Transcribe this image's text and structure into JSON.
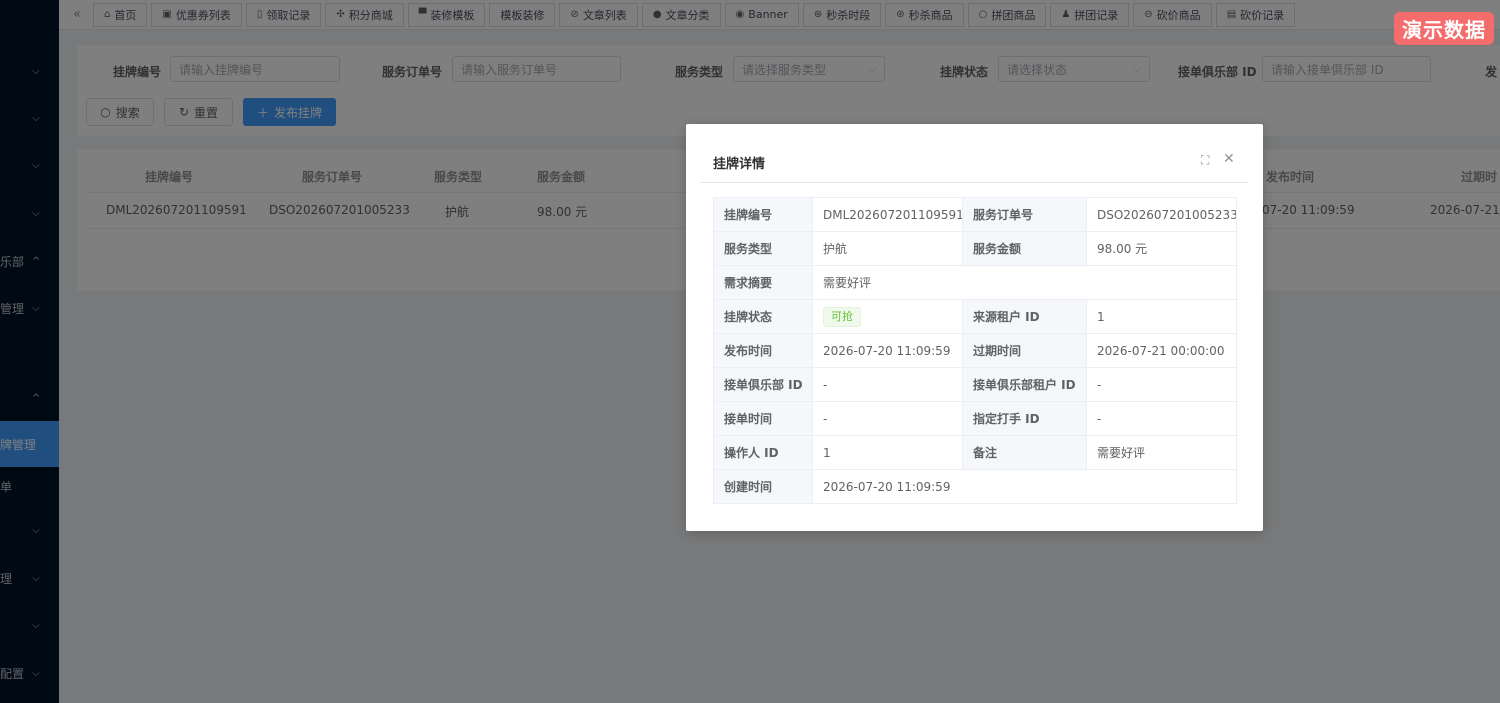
{
  "sidebar": {
    "items": [
      {
        "label": "",
        "chevron": "⌵"
      },
      {
        "label": "",
        "chevron": "⌵"
      },
      {
        "label": "",
        "chevron": "⌵"
      },
      {
        "label": "",
        "chevron": "⌵"
      },
      {
        "label": "乐部",
        "chevron": "^"
      },
      {
        "label": "管理",
        "chevron": "⌵"
      },
      {
        "label": "",
        "chevron": "^"
      },
      {
        "label": "牌管理",
        "chevron": ""
      },
      {
        "label": "单",
        "chevron": ""
      },
      {
        "label": "",
        "chevron": "⌵"
      },
      {
        "label": "理",
        "chevron": "⌵"
      },
      {
        "label": "",
        "chevron": "⌵"
      },
      {
        "label": "配置",
        "chevron": "⌵"
      }
    ]
  },
  "tags": [
    {
      "label": "首页",
      "icon": "home-icon",
      "glyph": "⌂"
    },
    {
      "label": "优惠券列表",
      "icon": "coupon-icon",
      "glyph": "▣"
    },
    {
      "label": "领取记录",
      "icon": "bookmark-icon",
      "glyph": "▯"
    },
    {
      "label": "积分商城",
      "icon": "points-icon",
      "glyph": "✣"
    },
    {
      "label": "装修模板",
      "icon": "template-icon",
      "glyph": "▀"
    },
    {
      "label": "模板装修",
      "icon": "",
      "glyph": ""
    },
    {
      "label": "文章列表",
      "icon": "article-icon",
      "glyph": "⊘"
    },
    {
      "label": "文章分类",
      "icon": "category-icon",
      "glyph": "●"
    },
    {
      "label": "Banner",
      "icon": "banner-icon",
      "glyph": "◉"
    },
    {
      "label": "秒杀时段",
      "icon": "seckill-time-icon",
      "glyph": "⊛"
    },
    {
      "label": "秒杀商品",
      "icon": "seckill-goods-icon",
      "glyph": "⊛"
    },
    {
      "label": "拼团商品",
      "icon": "group-goods-icon",
      "glyph": "○"
    },
    {
      "label": "拼团记录",
      "icon": "user-icon",
      "glyph": "♟"
    },
    {
      "label": "砍价商品",
      "icon": "bargain-goods-icon",
      "glyph": "⊖"
    },
    {
      "label": "砍价记录",
      "icon": "bargain-record-icon",
      "glyph": "▤"
    }
  ],
  "demo_badge": "演示数据",
  "filters": {
    "listing_no": {
      "label": "挂牌编号",
      "placeholder": "请输入挂牌编号"
    },
    "order_no": {
      "label": "服务订单号",
      "placeholder": "请输入服务订单号"
    },
    "service_type": {
      "label": "服务类型",
      "placeholder": "请选择服务类型"
    },
    "status": {
      "label": "挂牌状态",
      "placeholder": "请选择状态"
    },
    "club_id": {
      "label": "接单俱乐部 ID",
      "placeholder": "请输入接单俱乐部 ID"
    },
    "publish_cut": "发"
  },
  "buttons": {
    "search": "搜索",
    "reset": "重置",
    "publish": "发布挂牌"
  },
  "table": {
    "headers": [
      "挂牌编号",
      "服务订单号",
      "服务类型",
      "服务金额",
      "发布时间",
      "过期时"
    ],
    "row": {
      "listing_no": "DML202607201109591",
      "order_no": "DSO202607201005233",
      "service_type": "护航",
      "amount": "98.00 元",
      "publish_time_cut": "07-20 11:09:59",
      "expire_time_cut": "2026-07-21 0"
    }
  },
  "dialog": {
    "title": "挂牌详情",
    "rows": [
      {
        "k1": "挂牌编号",
        "v1": "DML202607201109591",
        "k2": "服务订单号",
        "v2": "DSO202607201005233"
      },
      {
        "k1": "服务类型",
        "v1": "护航",
        "k2": "服务金额",
        "v2": "98.00 元"
      },
      {
        "k1": "需求摘要",
        "v1": "需要好评"
      },
      {
        "k1": "挂牌状态",
        "v1": "可抢",
        "k2": "来源租户 ID",
        "v2": "1"
      },
      {
        "k1": "发布时间",
        "v1": "2026-07-20 11:09:59",
        "k2": "过期时间",
        "v2": "2026-07-21 00:00:00"
      },
      {
        "k1": "接单俱乐部 ID",
        "v1": "-",
        "k2": "接单俱乐部租户 ID",
        "v2": "-"
      },
      {
        "k1": "接单时间",
        "v1": "-",
        "k2": "指定打手 ID",
        "v2": "-"
      },
      {
        "k1": "操作人 ID",
        "v1": "1",
        "k2": "备注",
        "v2": "需要好评"
      },
      {
        "k1": "创建时间",
        "v1": "2026-07-20 11:09:59"
      }
    ]
  },
  "colors": {
    "primary": "#409eff",
    "sidebar": "#001529",
    "badge": "#f56c6c",
    "success": "#67c23a"
  }
}
